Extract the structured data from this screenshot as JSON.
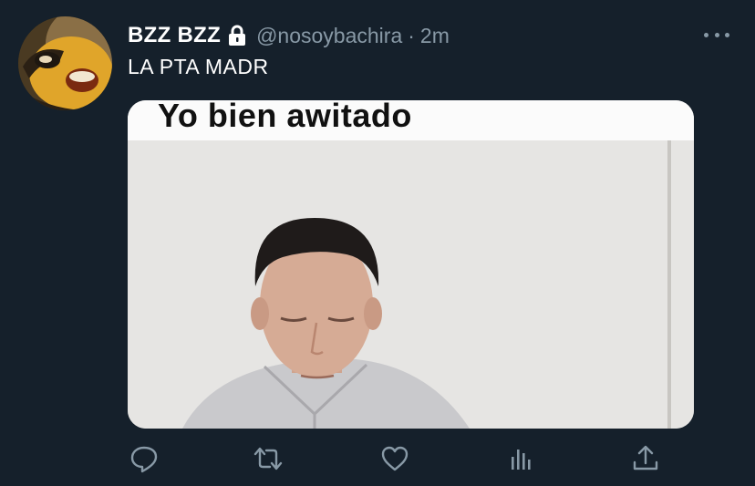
{
  "tweet": {
    "display_name": "BZZ BZZ",
    "handle": "@nosoybachira",
    "separator": "·",
    "time": "2m",
    "text": "LA PTA MADR",
    "media": {
      "caption": "Yo bien awitado"
    },
    "icons": {
      "protected": "lock-icon",
      "more": "more-options-icon",
      "reply": "reply-icon",
      "retweet": "retweet-icon",
      "like": "like-icon",
      "analytics": "analytics-icon",
      "share": "share-icon"
    }
  },
  "colors": {
    "background": "#15202b",
    "secondary_text": "#8899a6",
    "primary_text": "#ffffff"
  }
}
